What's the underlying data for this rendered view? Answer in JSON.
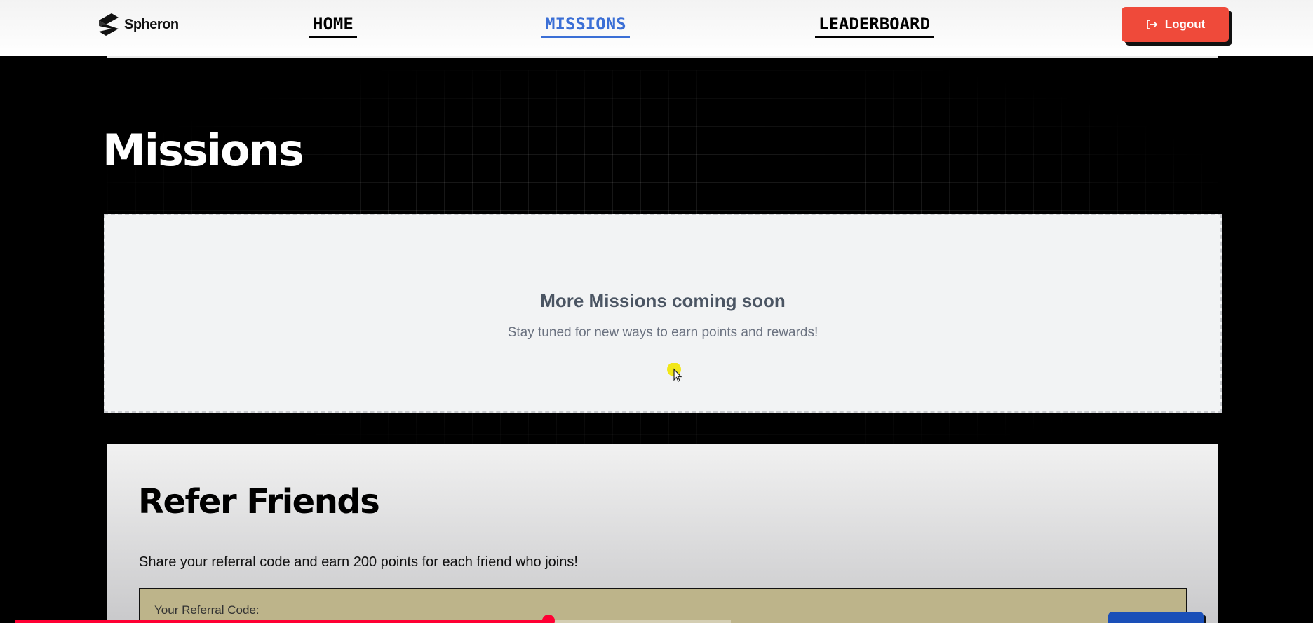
{
  "header": {
    "logo_text": "Spheron",
    "nav": {
      "home": "HOME",
      "missions": "MISSIONS",
      "leaderboard": "LEADERBOARD"
    },
    "logout_label": "Logout",
    "active_tab": "MISSIONS"
  },
  "main": {
    "title": "Missions",
    "empty_state": {
      "title": "More Missions coming soon",
      "subtitle": "Stay tuned for new ways to earn points and rewards!"
    }
  },
  "refer": {
    "title": "Refer Friends",
    "description": "Share your referral code and earn 200 points for each friend who joins!",
    "code_label": "Your Referral Code:"
  },
  "video_progress": {
    "fraction": 0.745
  },
  "colors": {
    "accent_blue": "#3b6fd6",
    "logout_red": "#ef4a3a",
    "progress_red": "#ff0033"
  }
}
